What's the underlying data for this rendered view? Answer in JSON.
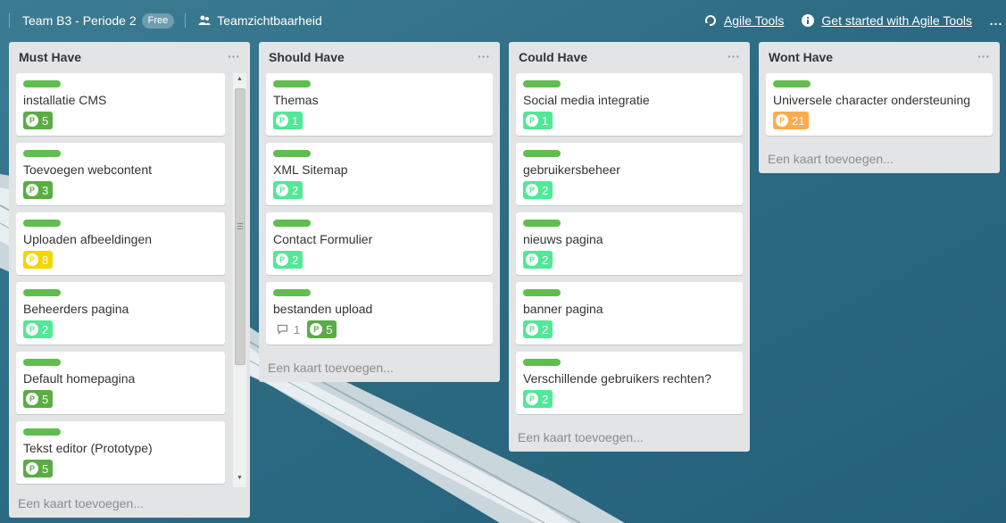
{
  "header": {
    "board_title": "Team B3 - Periode 2",
    "free_badge": "Free",
    "visibility": "Teamzichtbaarheid",
    "agile_tools": "Agile Tools",
    "get_started": "Get started with Agile Tools",
    "more": "..."
  },
  "colors": {
    "label_green": "#61bd4f",
    "points_green": "#5aac44",
    "points_lightgreen": "#51e898",
    "points_yellow": "#f2d600",
    "points_orange": "#ffab4a",
    "list_bg": "#e2e4e6"
  },
  "lists": [
    {
      "title": "Must Have",
      "menu": "···",
      "add_card": "Een kaart toevoegen...",
      "cards": [
        {
          "title": "installatie CMS",
          "label_color": "green",
          "points": "5",
          "points_color": "green"
        },
        {
          "title": "Toevoegen webcontent",
          "label_color": "green",
          "points": "3",
          "points_color": "green"
        },
        {
          "title": "Uploaden afbeeldingen",
          "label_color": "green",
          "points": "8",
          "points_color": "yellow"
        },
        {
          "title": "Beheerders pagina",
          "label_color": "green",
          "points": "2",
          "points_color": "lightgreen"
        },
        {
          "title": "Default homepagina",
          "label_color": "green",
          "points": "5",
          "points_color": "green"
        },
        {
          "title": "Tekst editor (Prototype)",
          "label_color": "green",
          "points": "5",
          "points_color": "green"
        }
      ]
    },
    {
      "title": "Should Have",
      "menu": "···",
      "add_card": "Een kaart toevoegen...",
      "cards": [
        {
          "title": "Themas",
          "label_color": "green",
          "points": "1",
          "points_color": "lightgreen"
        },
        {
          "title": "XML Sitemap",
          "label_color": "green",
          "points": "2",
          "points_color": "lightgreen"
        },
        {
          "title": "Contact Formulier",
          "label_color": "green",
          "points": "2",
          "points_color": "lightgreen"
        },
        {
          "title": "bestanden upload",
          "label_color": "green",
          "points": "5",
          "points_color": "green",
          "comments": "1"
        }
      ]
    },
    {
      "title": "Could Have",
      "menu": "···",
      "add_card": "Een kaart toevoegen...",
      "cards": [
        {
          "title": "Social media integratie",
          "label_color": "green",
          "points": "1",
          "points_color": "lightgreen"
        },
        {
          "title": "gebruikersbeheer",
          "label_color": "green",
          "points": "2",
          "points_color": "lightgreen"
        },
        {
          "title": "nieuws pagina",
          "label_color": "green",
          "points": "2",
          "points_color": "lightgreen"
        },
        {
          "title": "banner pagina",
          "label_color": "green",
          "points": "2",
          "points_color": "lightgreen"
        },
        {
          "title": "Verschillende gebruikers rechten?",
          "label_color": "green",
          "points": "2",
          "points_color": "lightgreen"
        }
      ]
    },
    {
      "title": "Wont Have",
      "menu": "···",
      "add_card": "Een kaart toevoegen...",
      "cards": [
        {
          "title": "Universele character ondersteuning",
          "label_color": "green",
          "points": "21",
          "points_color": "orange"
        }
      ]
    }
  ]
}
